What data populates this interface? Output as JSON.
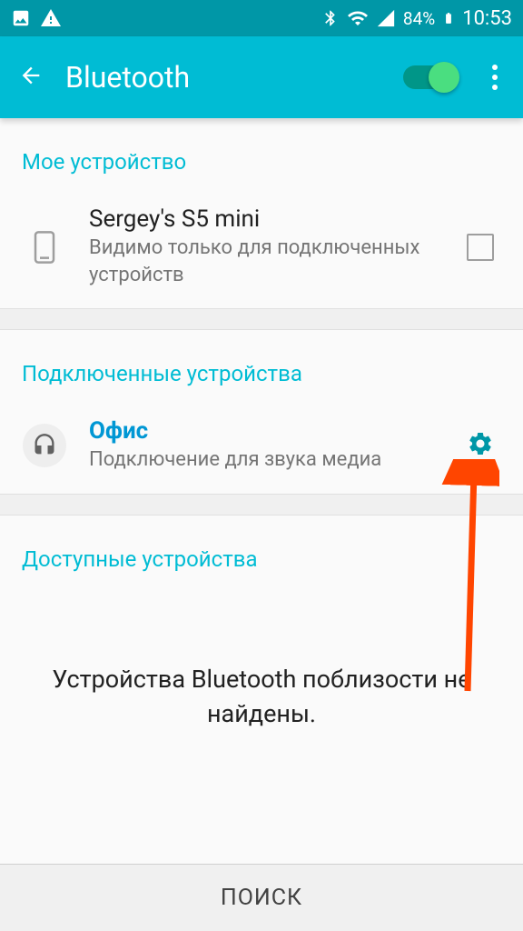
{
  "statusBar": {
    "batteryText": "84%",
    "time": "10:53"
  },
  "appBar": {
    "title": "Bluetooth"
  },
  "sections": {
    "myDevice": "Мое устройство",
    "connectedDevices": "Подключенные устройства",
    "availableDevices": "Доступные устройства"
  },
  "myDevice": {
    "name": "Sergey's S5 mini",
    "subtitle": "Видимо только для подключенных устройств"
  },
  "connectedDevice": {
    "name": "Офис",
    "subtitle": "Подключение для звука медиа"
  },
  "noDevices": "Устройства Bluetooth поблизости не найдены.",
  "searchButton": "ПОИСК"
}
